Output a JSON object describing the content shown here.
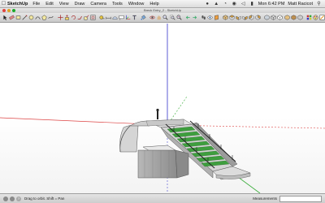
{
  "menubar": {
    "apple": "",
    "app_name": "SketchUp",
    "menus": [
      "File",
      "Edit",
      "View",
      "Draw",
      "Camera",
      "Tools",
      "Window",
      "Help"
    ],
    "clock": "Mon 6:42 PM",
    "user": "Matt Racicot"
  },
  "window": {
    "title": "Breck Entry_2 - SketchUp"
  },
  "toolbar": {
    "tools": [
      "select",
      "eraser",
      "rectangle",
      "line",
      "circle",
      "arc",
      "polygon",
      "freehand",
      "move",
      "push-pull",
      "rotate",
      "follow-me",
      "scale",
      "offset",
      "tape-measure",
      "dimension",
      "protractor",
      "text",
      "axes",
      "3d-text",
      "paint-bucket",
      "orbit",
      "pan",
      "zoom",
      "zoom-window",
      "zoom-extents",
      "previous",
      "next",
      "walk",
      "look-around",
      "section",
      "iso",
      "top",
      "front",
      "right",
      "back",
      "left",
      "xray",
      "wireframe",
      "hidden-line",
      "shaded",
      "shaded-textures",
      "monochrome",
      "components",
      "materials",
      "styles"
    ]
  },
  "status": {
    "hint": "Drag to orbit.  Shift = Pan",
    "measurements_label": "Measurements",
    "measurements_value": ""
  },
  "colors": {
    "axis_red": "#cc3333",
    "axis_green": "#33aa33",
    "axis_blue": "#3333cc",
    "rail_green": "#3a9a3a",
    "ramp_grey": "#9a9a9a"
  }
}
